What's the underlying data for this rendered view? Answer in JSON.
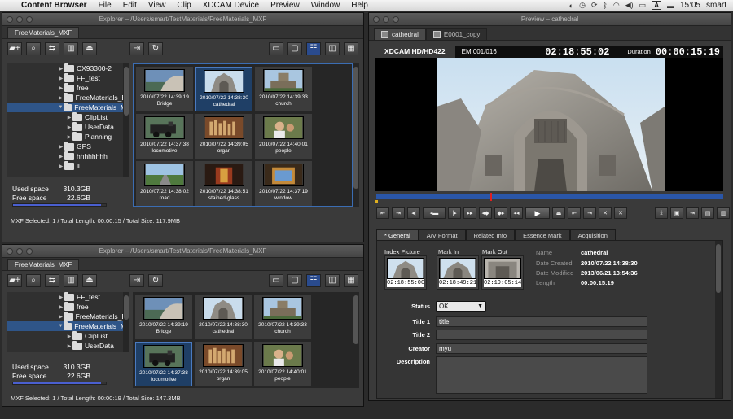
{
  "menubar": {
    "app": "Content Browser",
    "items": [
      "File",
      "Edit",
      "View",
      "Clip",
      "XDCAM Device",
      "Preview",
      "Window",
      "Help"
    ],
    "lang": "A",
    "clock": "15:05",
    "user": "smart"
  },
  "explorer_top": {
    "title": "Explorer – /Users/smart/TestMaterials/FreeMaterials_MXF",
    "tab": "FreeMaterials_MXF",
    "tree": [
      {
        "label": "CX93300-2",
        "expanded": false,
        "level": 0
      },
      {
        "label": "FF_test",
        "expanded": false,
        "level": 0
      },
      {
        "label": "free",
        "expanded": false,
        "level": 0
      },
      {
        "label": "FreeMaterials_E",
        "expanded": false,
        "level": 0
      },
      {
        "label": "FreeMaterials_M",
        "expanded": true,
        "level": 0,
        "selected": true
      },
      {
        "label": "ClipList",
        "expanded": false,
        "level": 1
      },
      {
        "label": "UserData",
        "expanded": false,
        "level": 1
      },
      {
        "label": "Planning",
        "expanded": false,
        "level": 1
      },
      {
        "label": "GPS",
        "expanded": false,
        "level": 0
      },
      {
        "label": "hhhhhhhh",
        "expanded": false,
        "level": 0
      },
      {
        "label": "ll",
        "expanded": false,
        "level": 0
      }
    ],
    "used_label": "Used space",
    "used_value": "310.3GB",
    "free_label": "Free space",
    "free_value": "22.6GB",
    "status": "MXF  Selected: 1 / Total Length: 00:00:15 / Total Size: 117.9MB",
    "clips": [
      {
        "date": "2010/07/22 14:39:19",
        "name": "Bridge",
        "thumb": "bridge"
      },
      {
        "date": "2010/07/22 14:38:30",
        "name": "cathedral",
        "thumb": "cathedral",
        "selected": true
      },
      {
        "date": "2010/07/22 14:39:33",
        "name": "church",
        "thumb": "church"
      },
      {
        "date": "2010/07/22 14:37:38",
        "name": "locomotive",
        "thumb": "locomotive"
      },
      {
        "date": "2010/07/22 14:39:05",
        "name": "organ",
        "thumb": "organ"
      },
      {
        "date": "2010/07/22 14:40:01",
        "name": "people",
        "thumb": "people"
      },
      {
        "date": "2010/07/22 14:38:02",
        "name": "road",
        "thumb": "road"
      },
      {
        "date": "2010/07/22 14:38:51",
        "name": "stained-glass",
        "thumb": "glass"
      },
      {
        "date": "2010/07/22 14:37:19",
        "name": "window",
        "thumb": "window"
      }
    ]
  },
  "explorer_bottom": {
    "title": "Explorer – /Users/smart/TestMaterials/FreeMaterials_MXF",
    "tab": "FreeMaterials_MXF",
    "tree": [
      {
        "label": "FF_test",
        "expanded": false,
        "level": 0
      },
      {
        "label": "free",
        "expanded": false,
        "level": 0
      },
      {
        "label": "FreeMaterials_E",
        "expanded": false,
        "level": 0
      },
      {
        "label": "FreeMaterials_M",
        "expanded": true,
        "level": 0,
        "selected": true
      },
      {
        "label": "ClipList",
        "expanded": false,
        "level": 1
      },
      {
        "label": "UserData",
        "expanded": false,
        "level": 1
      }
    ],
    "used_label": "Used space",
    "used_value": "310.3GB",
    "free_label": "Free space",
    "free_value": "22.6GB",
    "status": "MXF  Selected: 1 / Total Length: 00:00:19 / Total Size: 147.3MB",
    "clips": [
      {
        "date": "2010/07/22 14:39:19",
        "name": "Bridge",
        "thumb": "bridge"
      },
      {
        "date": "2010/07/22 14:38:30",
        "name": "cathedral",
        "thumb": "cathedral"
      },
      {
        "date": "2010/07/22 14:39:33",
        "name": "church",
        "thumb": "church"
      },
      {
        "date": "2010/07/22 14:37:38",
        "name": "locomotive",
        "thumb": "locomotive",
        "selected": true
      },
      {
        "date": "2010/07/22 14:39:05",
        "name": "organ",
        "thumb": "organ"
      },
      {
        "date": "2010/07/22 14:40:01",
        "name": "people",
        "thumb": "people"
      }
    ]
  },
  "preview": {
    "title": "Preview – cathedral",
    "tabs": [
      "cathedral",
      "E0001_copy"
    ],
    "format": "XDCAM HD/HD422",
    "em": "EM 001/016",
    "timecode": "02:18:55:02",
    "duration_label": "Duration",
    "duration": "00:00:15:19",
    "prop_tabs": [
      "* General",
      "A/V Format",
      "Related Info",
      "Essence Mark",
      "Acquisition"
    ],
    "index_label": "Index Picture",
    "index_tc": "02:18:55:00",
    "markin_label": "Mark In",
    "markin_tc": "02:18:49:21",
    "markout_label": "Mark Out",
    "markout_tc": "02:19:05:14",
    "info": [
      {
        "k": "Name",
        "v": "cathedral"
      },
      {
        "k": "Date Created",
        "v": "2010/07/22 14:38:30"
      },
      {
        "k": "Date Modified",
        "v": "2013/06/21 13:54:36"
      },
      {
        "k": "Length",
        "v": "00:00:15:19"
      }
    ],
    "status_label": "Status",
    "status_value": "OK",
    "title1_label": "Title 1",
    "title1_value": "title",
    "title2_label": "Title 2",
    "title2_value": "",
    "creator_label": "Creator",
    "creator_value": "myu",
    "description_label": "Description",
    "description_value": ""
  }
}
